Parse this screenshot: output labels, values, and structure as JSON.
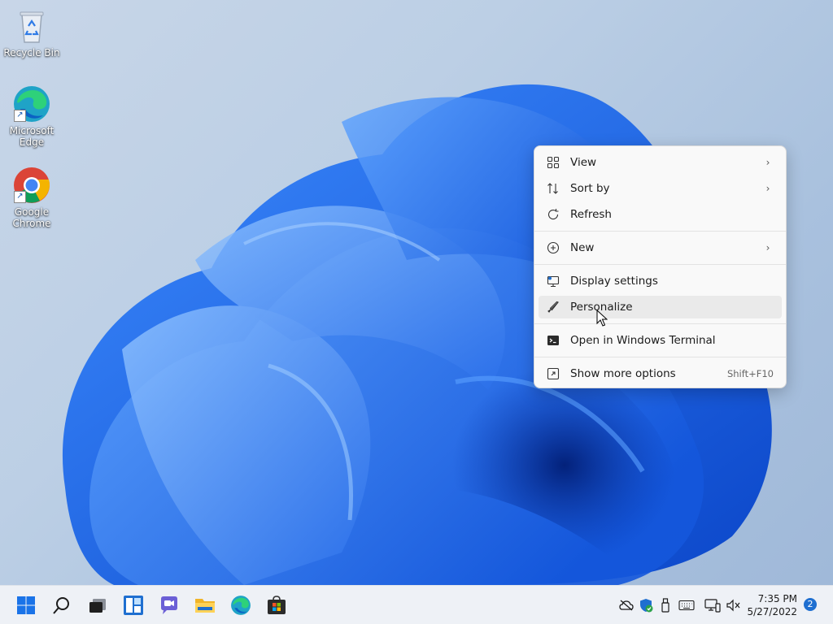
{
  "desktop": {
    "icons": [
      {
        "label": "Recycle Bin",
        "icon": "recycle-bin-icon"
      },
      {
        "label": "Microsoft Edge",
        "icon": "edge-icon"
      },
      {
        "label": "Google Chrome",
        "icon": "chrome-icon"
      }
    ]
  },
  "context_menu": {
    "items": [
      {
        "label": "View",
        "icon": "grid-icon",
        "submenu": true
      },
      {
        "label": "Sort by",
        "icon": "sort-icon",
        "submenu": true
      },
      {
        "label": "Refresh",
        "icon": "refresh-icon"
      },
      {
        "label": "New",
        "icon": "plus-circle-icon",
        "submenu": true
      },
      {
        "label": "Display settings",
        "icon": "display-icon"
      },
      {
        "label": "Personalize",
        "icon": "brush-icon",
        "hovered": true
      },
      {
        "label": "Open in Windows Terminal",
        "icon": "terminal-icon"
      },
      {
        "label": "Show more options",
        "icon": "more-options-icon",
        "shortcut": "Shift+F10"
      }
    ]
  },
  "taskbar": {
    "apps": [
      "start-icon",
      "search-icon",
      "task-view-icon",
      "widgets-icon",
      "teams-chat-icon",
      "file-explorer-icon",
      "edge-icon",
      "store-icon"
    ],
    "tray": [
      "onedrive-icon",
      "defender-icon",
      "usb-icon",
      "keyboard-icon",
      "network-icon",
      "volume-icon"
    ],
    "clock": {
      "time": "7:35 PM",
      "date": "5/27/2022"
    },
    "notification_count": "2"
  },
  "colors": {
    "accent": "#0067c0",
    "bloom": "#1a6ff0",
    "menu_bg": "#f9f9f9"
  }
}
